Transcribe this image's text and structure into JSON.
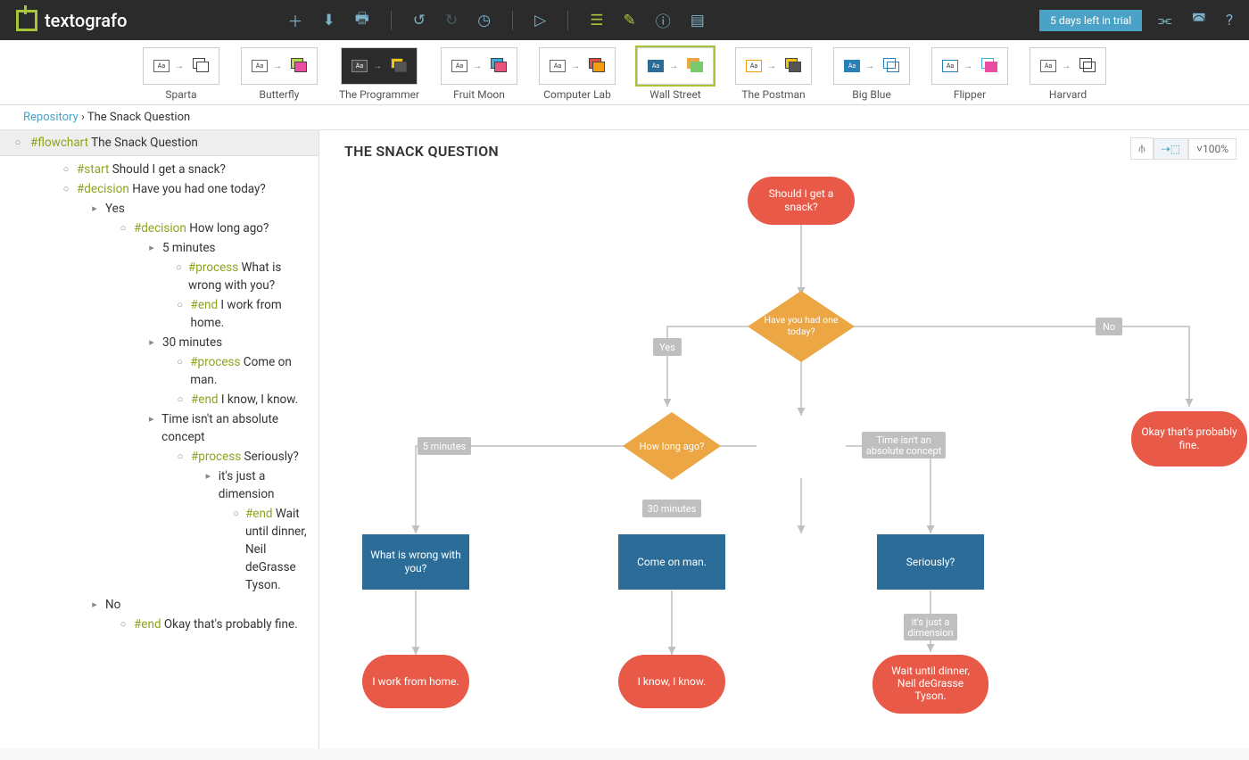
{
  "app": {
    "name": "textografo",
    "trial": "5 days left in trial"
  },
  "themes": [
    {
      "label": "Sparta"
    },
    {
      "label": "Butterfly"
    },
    {
      "label": "The Programmer"
    },
    {
      "label": "Fruit Moon"
    },
    {
      "label": "Computer Lab"
    },
    {
      "label": "Wall Street"
    },
    {
      "label": "The Postman"
    },
    {
      "label": "Big Blue"
    },
    {
      "label": "Flipper"
    },
    {
      "label": "Harvard"
    }
  ],
  "crumbs": {
    "repo": "Repository",
    "doc": "The Snack Question"
  },
  "tree": {
    "root": {
      "tag": "#flowchart",
      "text": "The Snack Question"
    },
    "items": [
      {
        "indent": 1,
        "b": "o",
        "tag": "#start",
        "text": "Should I get a snack?"
      },
      {
        "indent": 1,
        "b": "o",
        "tag": "#decision",
        "text": "Have you had one today?"
      },
      {
        "indent": 2,
        "b": ">",
        "text": "Yes"
      },
      {
        "indent": 3,
        "b": "o",
        "tag": "#decision",
        "text": "How long ago?"
      },
      {
        "indent": 4,
        "b": ">",
        "text": "5 minutes"
      },
      {
        "indent": 5,
        "b": "o",
        "tag": "#process",
        "text": " What is wrong with you?"
      },
      {
        "indent": 5,
        "b": "o",
        "tag": "#end",
        "text": "I work from home."
      },
      {
        "indent": 4,
        "b": ">",
        "text": "30 minutes"
      },
      {
        "indent": 5,
        "b": "o",
        "tag": "#process",
        "text": "Come on man."
      },
      {
        "indent": 5,
        "b": "o",
        "tag": "#end",
        "text": "I know, I know."
      },
      {
        "indent": 4,
        "b": ">",
        "text": "Time isn't an absolute concept"
      },
      {
        "indent": 5,
        "b": "o",
        "tag": "#process",
        "text": "Seriously?"
      },
      {
        "indent": 6,
        "b": ">",
        "text": "it's just a dimension"
      },
      {
        "indent": 7,
        "b": "o",
        "tag": "#end",
        "text": "Wait until dinner, Neil deGrasse Tyson."
      },
      {
        "indent": 2,
        "b": ">",
        "text": "No"
      },
      {
        "indent": 3,
        "b": "o",
        "tag": "#end",
        "text": "Okay that's probably fine."
      }
    ]
  },
  "canvas": {
    "title": "THE SNACK QUESTION",
    "zoom": "100%",
    "nodes": {
      "start": "Should I get a snack?",
      "d1": "Have you had one today?",
      "d2": "How long ago?",
      "p_wrong": "What is wrong with you?",
      "p_comeon": "Come on man.",
      "p_seriously": "Seriously?",
      "e_home": "I work from home.",
      "e_know": "I know, I know.",
      "e_wait1": "Wait until dinner,",
      "e_wait2": "Neil deGrasse",
      "e_wait3": "Tyson.",
      "e_fine": "Okay that's probably fine."
    },
    "labels": {
      "yes": "Yes",
      "no": "No",
      "m5": "5 minutes",
      "m30": "30 minutes",
      "time1": "Time isn't an",
      "time2": "absolute concept",
      "dim1": "it's just a",
      "dim2": "dimension"
    }
  }
}
